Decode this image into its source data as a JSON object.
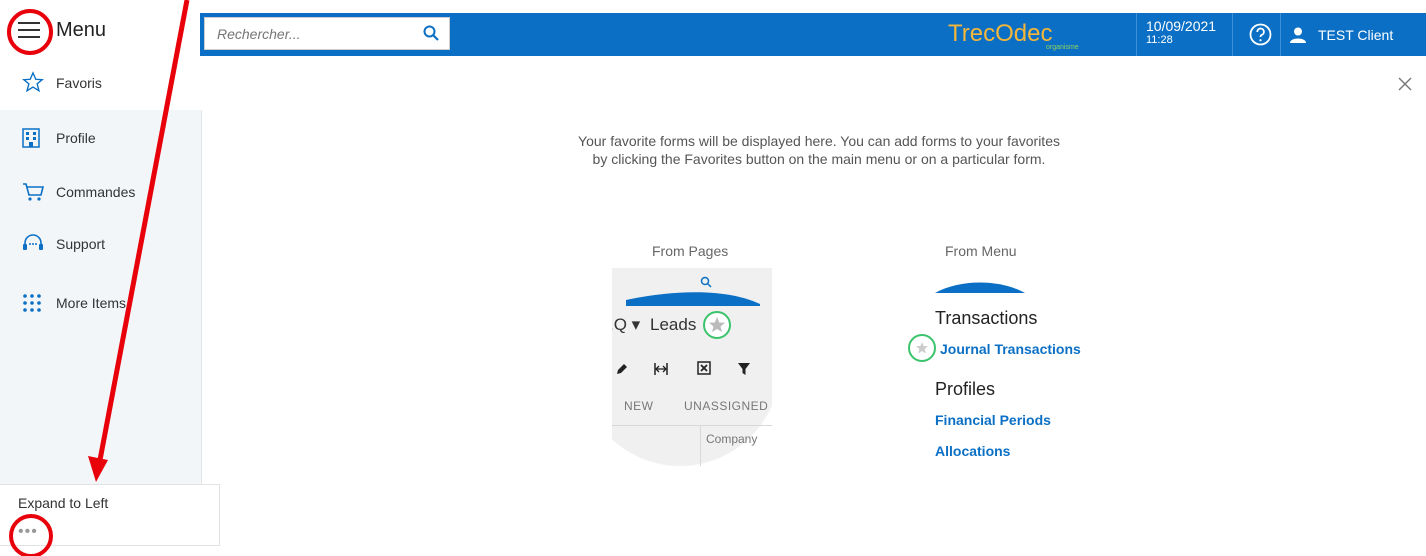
{
  "sidebar": {
    "menu_label": "Menu",
    "favorites_label": "Favoris",
    "items": [
      {
        "label": "Profile",
        "icon": "building-icon"
      },
      {
        "label": "Commandes",
        "icon": "cart-icon"
      },
      {
        "label": "Support",
        "icon": "headset-icon"
      },
      {
        "label": "More Items",
        "icon": "grid-dots-icon"
      }
    ],
    "expand_label": "Expand to Left",
    "more_label": "•••"
  },
  "header": {
    "search_placeholder": "Rechercher...",
    "logo_text": "TrecOdec",
    "logo_subtext": "organisme",
    "date": "10/09/2021",
    "time": "11:28",
    "user_name": "TEST Client"
  },
  "main": {
    "close_label": "×",
    "info_line1": "Your favorite forms will be displayed here. You can add forms to your favorites",
    "info_line2": "by clicking the Favorites button on the main menu or on a particular form.",
    "from_pages": {
      "title": "From Pages",
      "leads_prefix": ".Q ▾",
      "leads_label": "Leads",
      "tab_new": "NEW",
      "tab_unassigned": "UNASSIGNED",
      "column": "Company"
    },
    "from_menu": {
      "title": "From Menu",
      "section1": "Transactions",
      "link1": "Journal Transactions",
      "section2": "Profiles",
      "link2": "Financial Periods",
      "link3": "Allocations"
    }
  },
  "colors": {
    "brand_blue": "#0b70c5",
    "annotation_red": "#e8000b",
    "highlight_green": "#3cc46c"
  }
}
